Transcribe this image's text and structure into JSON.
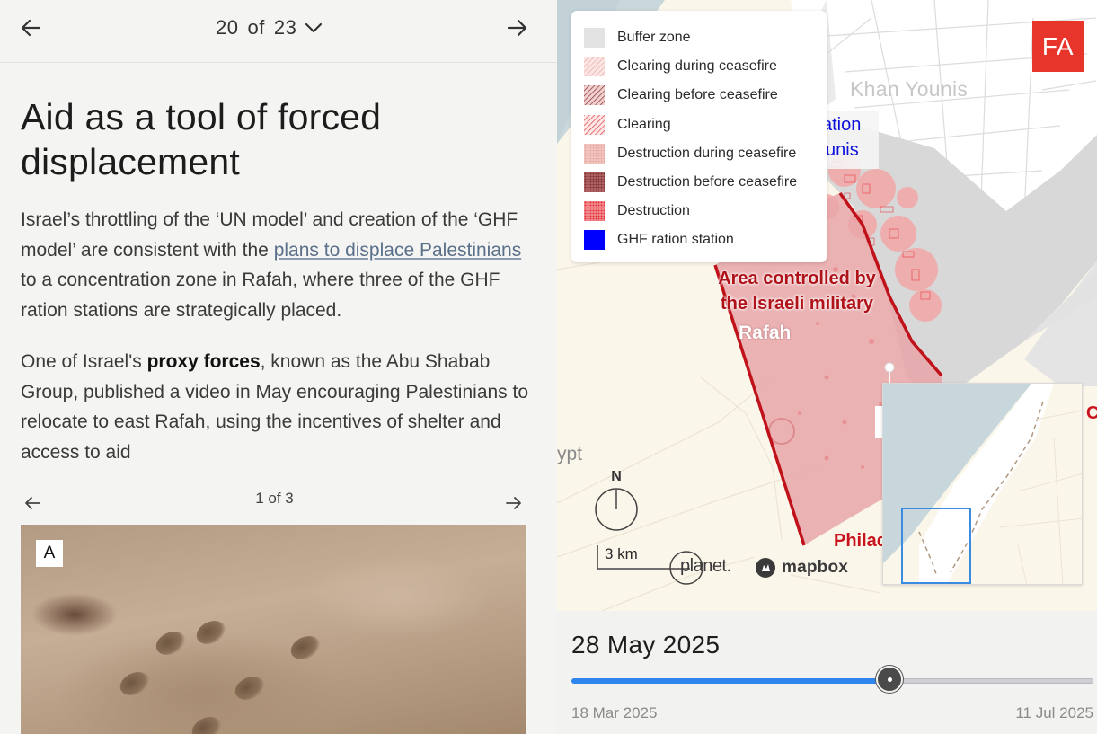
{
  "navigation": {
    "current": "20",
    "separator": "of",
    "total": "23"
  },
  "article": {
    "title": "Aid as a tool of forced displacement",
    "para1_before_link": "Israel’s throttling of the ‘UN model’ and creation of the ‘GHF model’ are consistent with the ",
    "para1_link": "plans to displace Palestinians",
    "para1_after_link": " to a concentration zone in Rafah, where three of the GHF ration stations are strategically placed.",
    "para2_before_bold": "One of Israel's ",
    "para2_bold": "proxy forces",
    "para2_after_bold": ", known as the Abu Shabab Group, published a video in May encouraging Palestinians to relocate to east Rafah, using the incentives of shelter and access to aid"
  },
  "gallery": {
    "counter": "1 of 3",
    "image_label": "A"
  },
  "map": {
    "logo": "FA",
    "legend": [
      {
        "label": "Buffer zone",
        "swatch": "buffer"
      },
      {
        "label": "Clearing during ceasefire",
        "swatch": "clearing-during"
      },
      {
        "label": "Clearing before ceasefire",
        "swatch": "clearing-before"
      },
      {
        "label": "Clearing",
        "swatch": "clearing"
      },
      {
        "label": "Destruction during ceasefire",
        "swatch": "destruction-during"
      },
      {
        "label": "Destruction before ceasefire",
        "swatch": "destruction-before"
      },
      {
        "label": "Destruction",
        "swatch": "destruction"
      },
      {
        "label": "GHF ration station",
        "swatch": "ghf"
      }
    ],
    "labels": {
      "khan_younis": "Khan Younis",
      "ration_line1": "ation",
      "ration_line2": "unis",
      "area_controlled": "Area controlled by the Israeli military",
      "rafah": "Rafah",
      "egypt": "ypt",
      "philadelphi": "Philad",
      "edge_c": "C"
    },
    "compass_label": "N",
    "scale_label": "3 km",
    "attribution_planet": "planet.",
    "attribution_mapbox": "mapbox",
    "colors": {
      "destruction": "#e8353d",
      "controlled_area_border": "#c0121a",
      "ghf": "#0000ff",
      "buffer": "#e3e3e3"
    }
  },
  "timeline": {
    "current_date": "28 May 2025",
    "start_date": "18 Mar 2025",
    "end_date": "11 Jul 2025",
    "progress": 0.61
  }
}
